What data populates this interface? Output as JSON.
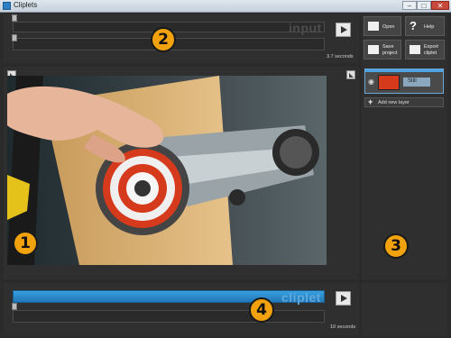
{
  "window": {
    "title": "Cliplets"
  },
  "input_panel": {
    "label": "input",
    "duration": "3.7 seconds"
  },
  "output_panel": {
    "label": "cliplet",
    "duration": "10 seconds"
  },
  "sidebar": {
    "open_label": "Open",
    "help_label": "Help",
    "save_label_line1": "Save",
    "save_label_line2": "project",
    "export_label_line1": "Export",
    "export_label_line2": "cliplet",
    "layer": {
      "name": "Still"
    },
    "add_layer_label": "Add new layer"
  },
  "annotations": {
    "one": "1",
    "two": "2",
    "three": "3",
    "four": "4"
  },
  "colors": {
    "accent": "#f2a20c",
    "timeline_blue": "#2a8ad0",
    "layer_highlight": "#4fa3e0"
  }
}
